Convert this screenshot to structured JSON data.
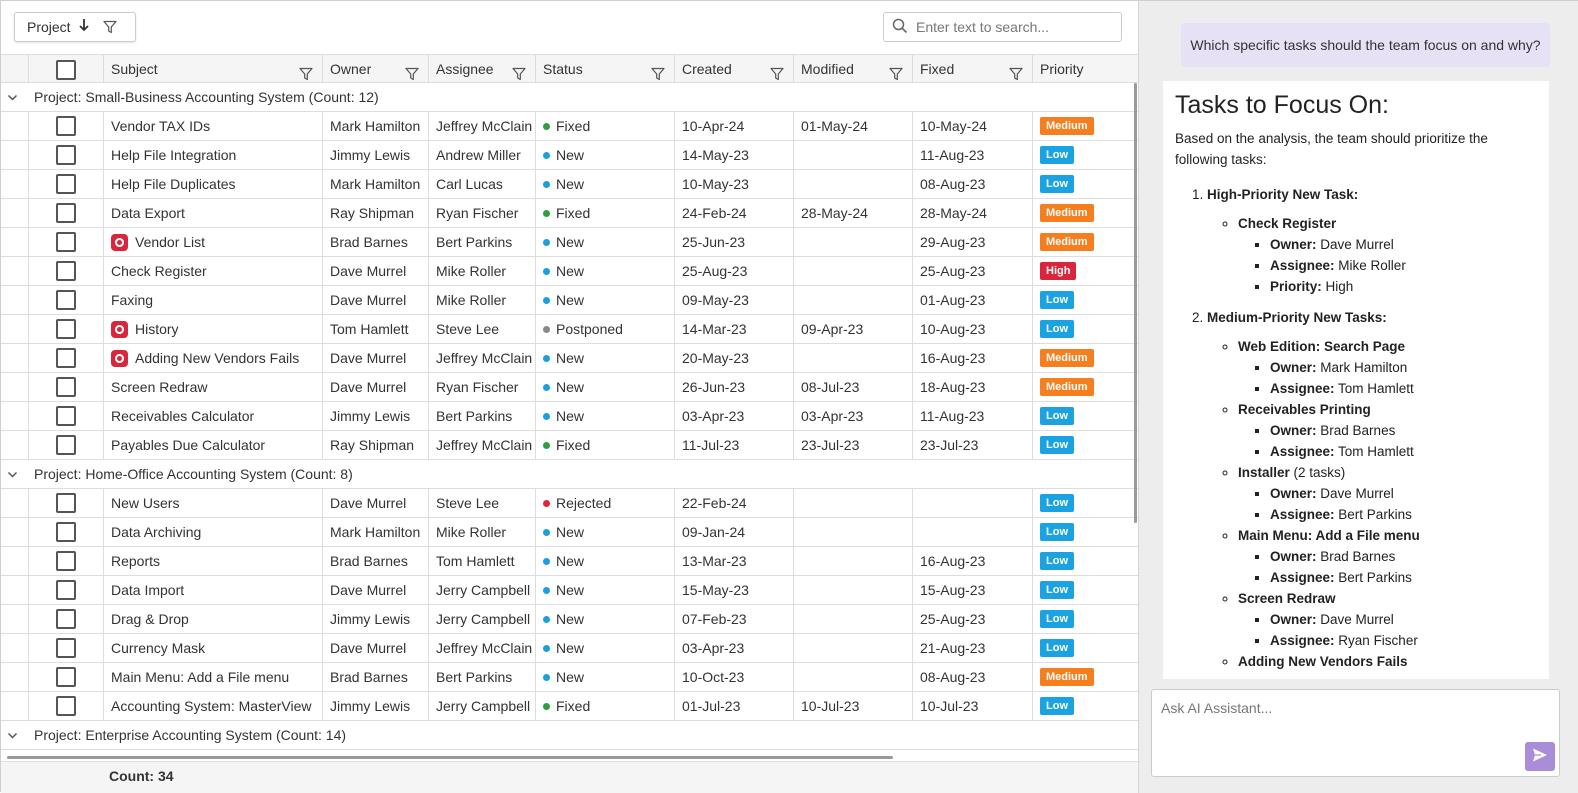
{
  "colors": {
    "status_new": "#1a9fdf",
    "status_fixed": "#2f9e3f",
    "status_postponed": "#888888",
    "status_rejected": "#e0243a",
    "priority_low": "#1aa3e0",
    "priority_medium": "#f57e1f",
    "priority_high": "#d9263d",
    "user_bubble": "#e6e1f5",
    "send_button": "#a98dd9"
  },
  "toolbar": {
    "group_chip_label": "Project",
    "sort_icon": "arrow-down-icon",
    "filter_icon": "filter-icon",
    "search_placeholder": "Enter text to search...",
    "search_icon": "search-icon"
  },
  "columns": {
    "subject": "Subject",
    "owner": "Owner",
    "assignee": "Assignee",
    "status": "Status",
    "created": "Created",
    "modified": "Modified",
    "fixed": "Fixed",
    "priority": "Priority"
  },
  "groups": [
    {
      "label": "Project: Small-Business Accounting System (Count: 12)",
      "rows": [
        {
          "subject": "Vendor TAX IDs",
          "flag": false,
          "owner": "Mark Hamilton",
          "assignee": "Jeffrey McClain",
          "status": "Fixed",
          "created": "10-Apr-24",
          "modified": "01-May-24",
          "fixed": "10-May-24",
          "priority": "Medium"
        },
        {
          "subject": "Help File Integration",
          "flag": false,
          "owner": "Jimmy Lewis",
          "assignee": "Andrew Miller",
          "status": "New",
          "created": "14-May-23",
          "modified": "",
          "fixed": "11-Aug-23",
          "priority": "Low"
        },
        {
          "subject": "Help File Duplicates",
          "flag": false,
          "owner": "Mark Hamilton",
          "assignee": "Carl Lucas",
          "status": "New",
          "created": "10-May-23",
          "modified": "",
          "fixed": "08-Aug-23",
          "priority": "Low"
        },
        {
          "subject": "Data Export",
          "flag": false,
          "owner": "Ray Shipman",
          "assignee": "Ryan Fischer",
          "status": "Fixed",
          "created": "24-Feb-24",
          "modified": "28-May-24",
          "fixed": "28-May-24",
          "priority": "Medium"
        },
        {
          "subject": "Vendor List",
          "flag": true,
          "owner": "Brad Barnes",
          "assignee": "Bert Parkins",
          "status": "New",
          "created": "25-Jun-23",
          "modified": "",
          "fixed": "29-Aug-23",
          "priority": "Medium"
        },
        {
          "subject": "Check Register",
          "flag": false,
          "owner": "Dave Murrel",
          "assignee": "Mike Roller",
          "status": "New",
          "created": "25-Aug-23",
          "modified": "",
          "fixed": "25-Aug-23",
          "priority": "High"
        },
        {
          "subject": "Faxing",
          "flag": false,
          "owner": "Dave Murrel",
          "assignee": "Mike Roller",
          "status": "New",
          "created": "09-May-23",
          "modified": "",
          "fixed": "01-Aug-23",
          "priority": "Low"
        },
        {
          "subject": "History",
          "flag": true,
          "owner": "Tom Hamlett",
          "assignee": "Steve Lee",
          "status": "Postponed",
          "created": "14-Mar-23",
          "modified": "09-Apr-23",
          "fixed": "10-Aug-23",
          "priority": "Low"
        },
        {
          "subject": "Adding New Vendors Fails",
          "flag": true,
          "owner": "Dave Murrel",
          "assignee": "Jeffrey McClain",
          "status": "New",
          "created": "20-May-23",
          "modified": "",
          "fixed": "16-Aug-23",
          "priority": "Medium"
        },
        {
          "subject": "Screen Redraw",
          "flag": false,
          "owner": "Dave Murrel",
          "assignee": "Ryan Fischer",
          "status": "New",
          "created": "26-Jun-23",
          "modified": "08-Jul-23",
          "fixed": "18-Aug-23",
          "priority": "Medium"
        },
        {
          "subject": "Receivables Calculator",
          "flag": false,
          "owner": "Jimmy Lewis",
          "assignee": "Bert Parkins",
          "status": "New",
          "created": "03-Apr-23",
          "modified": "03-Apr-23",
          "fixed": "11-Aug-23",
          "priority": "Low"
        },
        {
          "subject": "Payables Due Calculator",
          "flag": false,
          "owner": "Ray Shipman",
          "assignee": "Jeffrey McClain",
          "status": "Fixed",
          "created": "11-Jul-23",
          "modified": "23-Jul-23",
          "fixed": "23-Jul-23",
          "priority": "Low"
        }
      ]
    },
    {
      "label": "Project: Home-Office Accounting System (Count: 8)",
      "rows": [
        {
          "subject": "New Users",
          "flag": false,
          "owner": "Dave Murrel",
          "assignee": "Steve Lee",
          "status": "Rejected",
          "created": "22-Feb-24",
          "modified": "",
          "fixed": "",
          "priority": "Low"
        },
        {
          "subject": "Data Archiving",
          "flag": false,
          "owner": "Mark Hamilton",
          "assignee": "Mike Roller",
          "status": "New",
          "created": "09-Jan-24",
          "modified": "",
          "fixed": "",
          "priority": "Low"
        },
        {
          "subject": "Reports",
          "flag": false,
          "owner": "Brad Barnes",
          "assignee": "Tom Hamlett",
          "status": "New",
          "created": "13-Mar-23",
          "modified": "",
          "fixed": "16-Aug-23",
          "priority": "Low"
        },
        {
          "subject": "Data Import",
          "flag": false,
          "owner": "Dave Murrel",
          "assignee": "Jerry Campbell",
          "status": "New",
          "created": "15-May-23",
          "modified": "",
          "fixed": "15-Aug-23",
          "priority": "Low"
        },
        {
          "subject": "Drag & Drop",
          "flag": false,
          "owner": "Jimmy Lewis",
          "assignee": "Jerry Campbell",
          "status": "New",
          "created": "07-Feb-23",
          "modified": "",
          "fixed": "25-Aug-23",
          "priority": "Low"
        },
        {
          "subject": "Currency Mask",
          "flag": false,
          "owner": "Dave Murrel",
          "assignee": "Jeffrey McClain",
          "status": "New",
          "created": "03-Apr-23",
          "modified": "",
          "fixed": "21-Aug-23",
          "priority": "Low"
        },
        {
          "subject": "Main Menu: Add a File menu",
          "flag": false,
          "owner": "Brad Barnes",
          "assignee": "Bert Parkins",
          "status": "New",
          "created": "10-Oct-23",
          "modified": "",
          "fixed": "08-Aug-23",
          "priority": "Medium"
        },
        {
          "subject": "Accounting System: MasterView",
          "flag": false,
          "owner": "Jimmy Lewis",
          "assignee": "Jerry Campbell",
          "status": "Fixed",
          "created": "01-Jul-23",
          "modified": "10-Jul-23",
          "fixed": "10-Jul-23",
          "priority": "Low"
        }
      ]
    },
    {
      "label": "Project: Enterprise Accounting System (Count: 14)",
      "rows": []
    }
  ],
  "footer": {
    "count": "Count: 34"
  },
  "ai": {
    "user_question": "Which specific tasks should the team focus on and why?",
    "title": "Tasks to Focus On:",
    "intro": "Based on the analysis, the team should prioritize the following tasks:",
    "sections": [
      {
        "heading": "High-Priority New Task:",
        "tasks": [
          {
            "name": "Check Register",
            "note": "",
            "details": [
              {
                "k": "Owner:",
                "v": "Dave Murrel"
              },
              {
                "k": "Assignee:",
                "v": "Mike Roller"
              },
              {
                "k": "Priority:",
                "v": "High"
              }
            ]
          }
        ]
      },
      {
        "heading": "Medium-Priority New Tasks:",
        "tasks": [
          {
            "name": "Web Edition: Search Page",
            "note": "",
            "details": [
              {
                "k": "Owner:",
                "v": "Mark Hamilton"
              },
              {
                "k": "Assignee:",
                "v": "Tom Hamlett"
              }
            ]
          },
          {
            "name": "Receivables Printing",
            "note": "",
            "details": [
              {
                "k": "Owner:",
                "v": "Brad Barnes"
              },
              {
                "k": "Assignee:",
                "v": "Tom Hamlett"
              }
            ]
          },
          {
            "name": "Installer",
            "note": " (2 tasks)",
            "details": [
              {
                "k": "Owner:",
                "v": "Dave Murrel"
              },
              {
                "k": "Assignee:",
                "v": "Bert Parkins"
              }
            ]
          },
          {
            "name": "Main Menu: Add a File menu",
            "note": "",
            "details": [
              {
                "k": "Owner:",
                "v": "Brad Barnes"
              },
              {
                "k": "Assignee:",
                "v": "Bert Parkins"
              }
            ]
          },
          {
            "name": "Screen Redraw",
            "note": "",
            "details": [
              {
                "k": "Owner:",
                "v": "Dave Murrel"
              },
              {
                "k": "Assignee:",
                "v": "Ryan Fischer"
              }
            ]
          },
          {
            "name": "Adding New Vendors Fails",
            "note": "",
            "details": []
          }
        ]
      }
    ],
    "input_placeholder": "Ask AI Assistant...",
    "send_icon": "send-icon"
  }
}
